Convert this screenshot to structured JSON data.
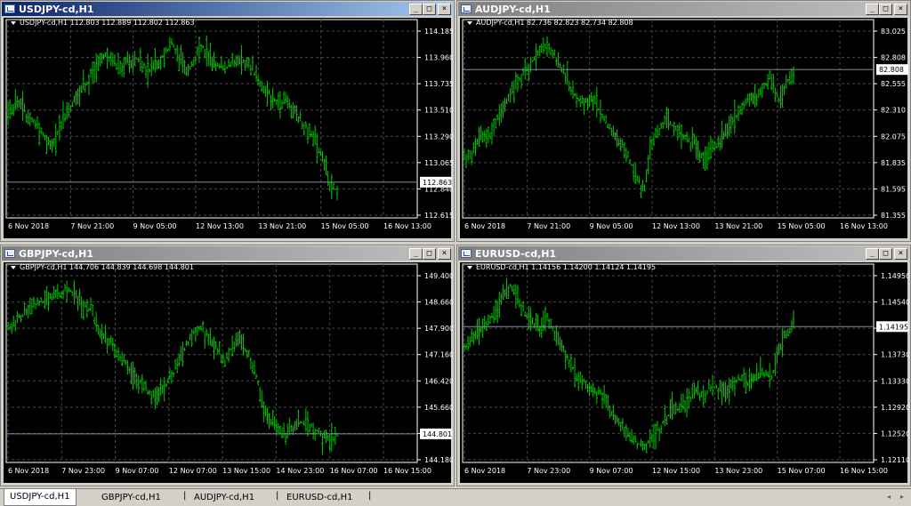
{
  "windows": [
    {
      "key": "usdjpy",
      "title": "USDJPY-cd,H1",
      "active": true,
      "info": "USDJPY-cd,H1  112.803 112.889 112.802 112.863",
      "price_labels": [
        "114.185",
        "113.960",
        "113.735",
        "113.510",
        "113.290",
        "113.065",
        "112.840",
        "112.615"
      ],
      "current_price": "112.863",
      "current_level": 0.17,
      "time_labels": [
        "6 Nov 2018",
        "7 Nov 21:00",
        "9 Nov 05:00",
        "12 Nov 13:00",
        "13 Nov 21:00",
        "15 Nov 05:00",
        "16 Nov 13:00"
      ],
      "path": [
        0.55,
        0.62,
        0.58,
        0.52,
        0.48,
        0.4,
        0.36,
        0.5,
        0.58,
        0.62,
        0.7,
        0.75,
        0.82,
        0.88,
        0.86,
        0.8,
        0.84,
        0.87,
        0.83,
        0.78,
        0.84,
        0.9,
        0.95,
        0.86,
        0.8,
        0.86,
        0.92,
        0.88,
        0.82,
        0.8,
        0.84,
        0.86,
        0.83,
        0.78,
        0.7,
        0.66,
        0.6,
        0.64,
        0.58,
        0.52,
        0.46,
        0.4,
        0.3,
        0.16,
        0.12
      ]
    },
    {
      "key": "audjpy",
      "title": "AUDJPY-cd,H1",
      "active": false,
      "info": "AUDJPY-cd,H1  82.736 82.823 82.734 82.808",
      "price_labels": [
        "83.025",
        "82.808",
        "82.555",
        "82.310",
        "82.075",
        "81.835",
        "81.595",
        "81.355"
      ],
      "current_price": "82.808",
      "current_level": 0.8,
      "time_labels": [
        "6 Nov 2018",
        "7 Nov 21:00",
        "9 Nov 05:00",
        "12 Nov 13:00",
        "13 Nov 21:00",
        "15 Nov 05:00",
        "16 Nov 13:00"
      ],
      "path": [
        0.3,
        0.34,
        0.4,
        0.42,
        0.48,
        0.58,
        0.66,
        0.72,
        0.78,
        0.84,
        0.9,
        0.95,
        0.88,
        0.8,
        0.72,
        0.64,
        0.6,
        0.66,
        0.58,
        0.5,
        0.44,
        0.38,
        0.3,
        0.2,
        0.12,
        0.4,
        0.46,
        0.52,
        0.48,
        0.44,
        0.4,
        0.38,
        0.3,
        0.36,
        0.4,
        0.46,
        0.52,
        0.58,
        0.62,
        0.66,
        0.7,
        0.76,
        0.62,
        0.7,
        0.8
      ]
    },
    {
      "key": "gbpjpy",
      "title": "GBPJPY-cd,H1",
      "active": false,
      "info": "GBPJPY-cd,H1  144.706 144.839 144.698 144.801",
      "price_labels": [
        "149.400",
        "148.660",
        "147.900",
        "147.160",
        "146.420",
        "145.660",
        "144.920",
        "144.180"
      ],
      "current_price": "144.801",
      "current_level": 0.13,
      "time_labels": [
        "6 Nov 2018",
        "7 Nov 23:00",
        "9 Nov 07:00",
        "12 Nov 07:00",
        "13 Nov 15:00",
        "14 Nov 23:00",
        "16 Nov 07:00",
        "16 Nov 15:00"
      ],
      "path": [
        0.72,
        0.76,
        0.8,
        0.84,
        0.86,
        0.88,
        0.9,
        0.92,
        0.95,
        0.9,
        0.86,
        0.82,
        0.74,
        0.66,
        0.62,
        0.56,
        0.5,
        0.44,
        0.4,
        0.36,
        0.34,
        0.4,
        0.46,
        0.56,
        0.64,
        0.7,
        0.72,
        0.66,
        0.6,
        0.54,
        0.62,
        0.66,
        0.58,
        0.5,
        0.28,
        0.2,
        0.14,
        0.12,
        0.16,
        0.2,
        0.18,
        0.16,
        0.12,
        0.1,
        0.12
      ]
    },
    {
      "key": "eurusd",
      "title": "EURUSD-cd,H1",
      "active": false,
      "info": "EURUSD-cd,H1  1.14156 1.14200 1.14124 1.14195",
      "price_labels": [
        "1.14950",
        "1.14540",
        "1.14195",
        "1.13730",
        "1.13330",
        "1.12920",
        "1.12520",
        "1.12110"
      ],
      "current_price": "1.14195",
      "current_level": 0.73,
      "time_labels": [
        "6 Nov 2018",
        "7 Nov 23:00",
        "9 Nov 07:00",
        "12 Nov 15:00",
        "13 Nov 23:00",
        "15 Nov 07:00",
        "16 Nov 15:00"
      ],
      "path": [
        0.62,
        0.66,
        0.7,
        0.74,
        0.8,
        0.88,
        0.96,
        0.9,
        0.82,
        0.76,
        0.72,
        0.78,
        0.7,
        0.62,
        0.52,
        0.46,
        0.42,
        0.38,
        0.36,
        0.3,
        0.22,
        0.16,
        0.12,
        0.08,
        0.06,
        0.1,
        0.16,
        0.22,
        0.28,
        0.26,
        0.32,
        0.36,
        0.34,
        0.4,
        0.38,
        0.36,
        0.42,
        0.44,
        0.4,
        0.46,
        0.48,
        0.44,
        0.6,
        0.68,
        0.74
      ]
    }
  ],
  "tabs": [
    "USDJPY-cd,H1",
    "GBPJPY-cd,H1",
    "AUDJPY-cd,H1",
    "EURUSD-cd,H1"
  ],
  "tab_separator": "|",
  "window_buttons": {
    "minimize": "_",
    "maximize": "□",
    "close": "×"
  },
  "scroll_arrows": {
    "left": "◂",
    "right": "▸"
  },
  "colors": {
    "bars": "#00c800",
    "grid": "#4a4a4a",
    "axis_text": "#ffffff",
    "current_line": "#7f8c9c",
    "background": "#000000"
  }
}
